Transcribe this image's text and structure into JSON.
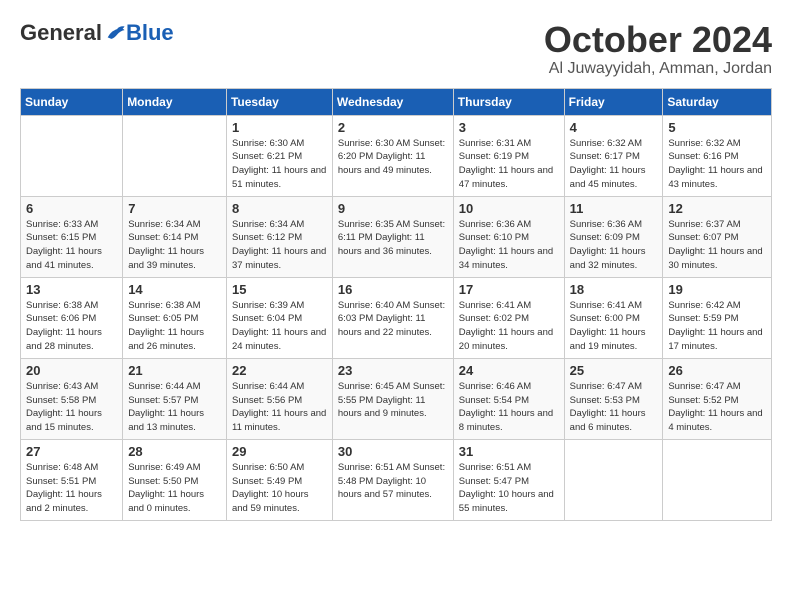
{
  "logo": {
    "general": "General",
    "blue": "Blue"
  },
  "title": "October 2024",
  "location": "Al Juwayyidah, Amman, Jordan",
  "headers": [
    "Sunday",
    "Monday",
    "Tuesday",
    "Wednesday",
    "Thursday",
    "Friday",
    "Saturday"
  ],
  "weeks": [
    [
      {
        "day": "",
        "info": ""
      },
      {
        "day": "",
        "info": ""
      },
      {
        "day": "1",
        "info": "Sunrise: 6:30 AM\nSunset: 6:21 PM\nDaylight: 11 hours and 51 minutes."
      },
      {
        "day": "2",
        "info": "Sunrise: 6:30 AM\nSunset: 6:20 PM\nDaylight: 11 hours and 49 minutes."
      },
      {
        "day": "3",
        "info": "Sunrise: 6:31 AM\nSunset: 6:19 PM\nDaylight: 11 hours and 47 minutes."
      },
      {
        "day": "4",
        "info": "Sunrise: 6:32 AM\nSunset: 6:17 PM\nDaylight: 11 hours and 45 minutes."
      },
      {
        "day": "5",
        "info": "Sunrise: 6:32 AM\nSunset: 6:16 PM\nDaylight: 11 hours and 43 minutes."
      }
    ],
    [
      {
        "day": "6",
        "info": "Sunrise: 6:33 AM\nSunset: 6:15 PM\nDaylight: 11 hours and 41 minutes."
      },
      {
        "day": "7",
        "info": "Sunrise: 6:34 AM\nSunset: 6:14 PM\nDaylight: 11 hours and 39 minutes."
      },
      {
        "day": "8",
        "info": "Sunrise: 6:34 AM\nSunset: 6:12 PM\nDaylight: 11 hours and 37 minutes."
      },
      {
        "day": "9",
        "info": "Sunrise: 6:35 AM\nSunset: 6:11 PM\nDaylight: 11 hours and 36 minutes."
      },
      {
        "day": "10",
        "info": "Sunrise: 6:36 AM\nSunset: 6:10 PM\nDaylight: 11 hours and 34 minutes."
      },
      {
        "day": "11",
        "info": "Sunrise: 6:36 AM\nSunset: 6:09 PM\nDaylight: 11 hours and 32 minutes."
      },
      {
        "day": "12",
        "info": "Sunrise: 6:37 AM\nSunset: 6:07 PM\nDaylight: 11 hours and 30 minutes."
      }
    ],
    [
      {
        "day": "13",
        "info": "Sunrise: 6:38 AM\nSunset: 6:06 PM\nDaylight: 11 hours and 28 minutes."
      },
      {
        "day": "14",
        "info": "Sunrise: 6:38 AM\nSunset: 6:05 PM\nDaylight: 11 hours and 26 minutes."
      },
      {
        "day": "15",
        "info": "Sunrise: 6:39 AM\nSunset: 6:04 PM\nDaylight: 11 hours and 24 minutes."
      },
      {
        "day": "16",
        "info": "Sunrise: 6:40 AM\nSunset: 6:03 PM\nDaylight: 11 hours and 22 minutes."
      },
      {
        "day": "17",
        "info": "Sunrise: 6:41 AM\nSunset: 6:02 PM\nDaylight: 11 hours and 20 minutes."
      },
      {
        "day": "18",
        "info": "Sunrise: 6:41 AM\nSunset: 6:00 PM\nDaylight: 11 hours and 19 minutes."
      },
      {
        "day": "19",
        "info": "Sunrise: 6:42 AM\nSunset: 5:59 PM\nDaylight: 11 hours and 17 minutes."
      }
    ],
    [
      {
        "day": "20",
        "info": "Sunrise: 6:43 AM\nSunset: 5:58 PM\nDaylight: 11 hours and 15 minutes."
      },
      {
        "day": "21",
        "info": "Sunrise: 6:44 AM\nSunset: 5:57 PM\nDaylight: 11 hours and 13 minutes."
      },
      {
        "day": "22",
        "info": "Sunrise: 6:44 AM\nSunset: 5:56 PM\nDaylight: 11 hours and 11 minutes."
      },
      {
        "day": "23",
        "info": "Sunrise: 6:45 AM\nSunset: 5:55 PM\nDaylight: 11 hours and 9 minutes."
      },
      {
        "day": "24",
        "info": "Sunrise: 6:46 AM\nSunset: 5:54 PM\nDaylight: 11 hours and 8 minutes."
      },
      {
        "day": "25",
        "info": "Sunrise: 6:47 AM\nSunset: 5:53 PM\nDaylight: 11 hours and 6 minutes."
      },
      {
        "day": "26",
        "info": "Sunrise: 6:47 AM\nSunset: 5:52 PM\nDaylight: 11 hours and 4 minutes."
      }
    ],
    [
      {
        "day": "27",
        "info": "Sunrise: 6:48 AM\nSunset: 5:51 PM\nDaylight: 11 hours and 2 minutes."
      },
      {
        "day": "28",
        "info": "Sunrise: 6:49 AM\nSunset: 5:50 PM\nDaylight: 11 hours and 0 minutes."
      },
      {
        "day": "29",
        "info": "Sunrise: 6:50 AM\nSunset: 5:49 PM\nDaylight: 10 hours and 59 minutes."
      },
      {
        "day": "30",
        "info": "Sunrise: 6:51 AM\nSunset: 5:48 PM\nDaylight: 10 hours and 57 minutes."
      },
      {
        "day": "31",
        "info": "Sunrise: 6:51 AM\nSunset: 5:47 PM\nDaylight: 10 hours and 55 minutes."
      },
      {
        "day": "",
        "info": ""
      },
      {
        "day": "",
        "info": ""
      }
    ]
  ]
}
